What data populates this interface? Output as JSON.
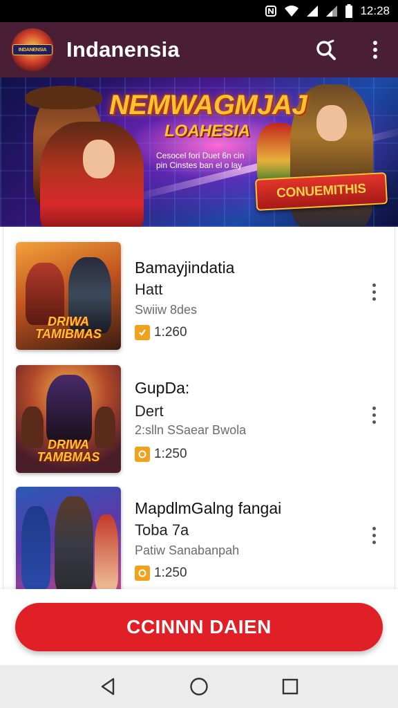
{
  "status_bar": {
    "time": "12:28",
    "icons": [
      "nfc-icon",
      "wifi-icon",
      "signal-icon",
      "signal-icon",
      "battery-icon"
    ]
  },
  "app_bar": {
    "logo_text": "INDANENSIA",
    "title": "Indanensia",
    "actions": [
      "search-icon",
      "more-vert-icon"
    ]
  },
  "banner": {
    "title": "NEMWAGMJAJ",
    "subtitle": "LOAHESIA",
    "caption": "Cesocel fori Duet 6n cin pin Cinstes ban el o lay",
    "ribbon": "CONUEMITHIS",
    "colors": {
      "accent": "#ffc233",
      "ribbon": "#e2352c"
    }
  },
  "games": [
    {
      "title": "Bamayjindatia",
      "subtitle": "Hatt",
      "meta": "Swiiw 8des",
      "price": "1:260",
      "thumb_logo": "DRIWA TAMIBMAS"
    },
    {
      "title": "GupDa:",
      "subtitle": "Dert",
      "meta": "2:slln SSaear Bwola",
      "price": "1:250",
      "thumb_logo": "DRIWA TAMBMAS"
    },
    {
      "title": "MapdlmGalng fangai",
      "subtitle": "Toba 7a",
      "meta": "Patiw Sanabanpah",
      "price": "1:250",
      "thumb_logo": ""
    }
  ],
  "cta": {
    "label": "CCINNN DAIEN",
    "color": "#e01f26"
  },
  "nav_bar": [
    "back-icon",
    "home-icon",
    "recents-icon"
  ],
  "colors": {
    "app_bar": "#4a1f36",
    "coin": "#f0a21e"
  }
}
